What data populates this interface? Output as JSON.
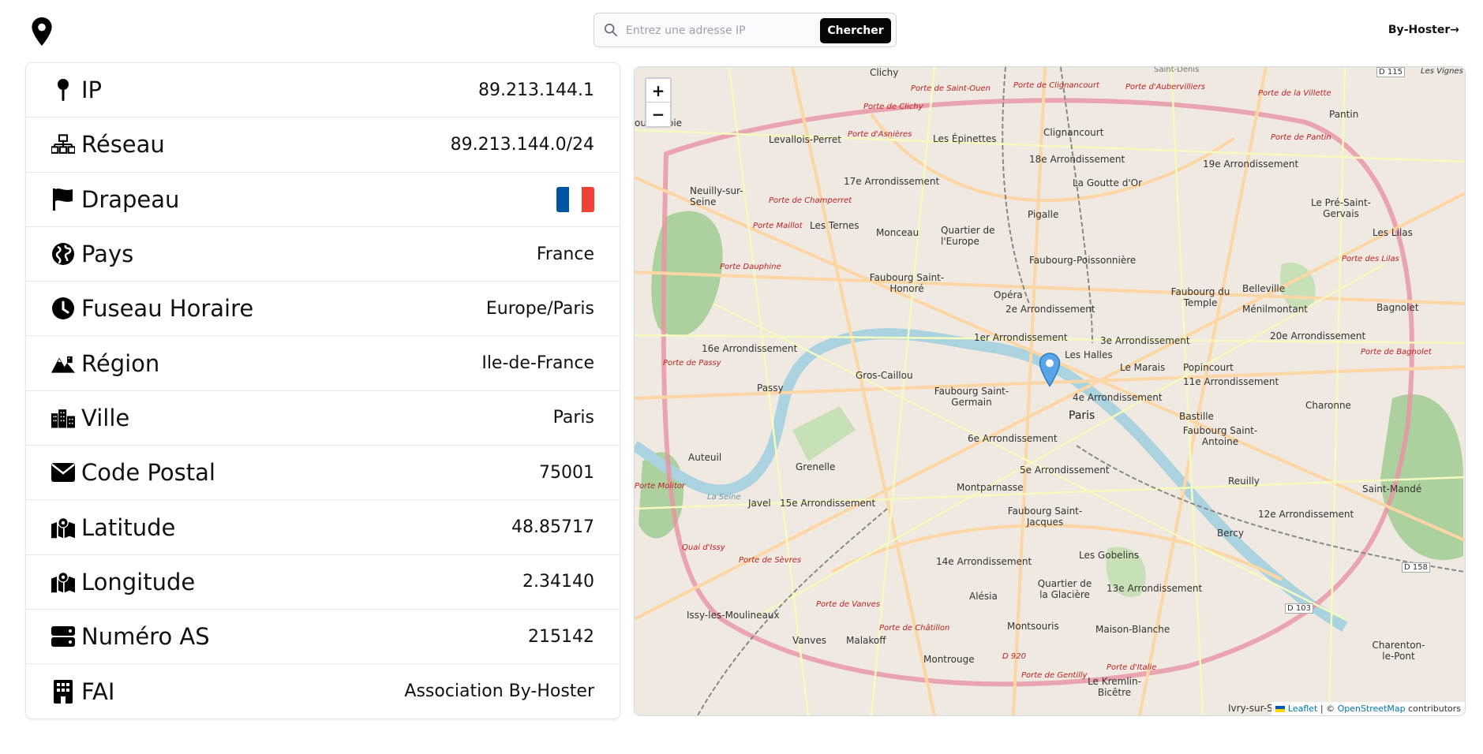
{
  "header": {
    "search": {
      "placeholder": "Entrez une adresse IP",
      "button_label": "Chercher"
    },
    "brand_link": "By-Hoster→"
  },
  "info": {
    "rows": [
      {
        "label": "IP",
        "value": "89.213.144.1",
        "icon": "pin-icon"
      },
      {
        "label": "Réseau",
        "value": "89.213.144.0/24",
        "icon": "network-icon"
      },
      {
        "label": "Drapeau",
        "value": "",
        "icon": "flag-icon"
      },
      {
        "label": "Pays",
        "value": "France",
        "icon": "globe-icon"
      },
      {
        "label": "Fuseau Horaire",
        "value": "Europe/Paris",
        "icon": "clock-icon"
      },
      {
        "label": "Région",
        "value": "Ile-de-France",
        "icon": "mountain-city-icon"
      },
      {
        "label": "Ville",
        "value": "Paris",
        "icon": "city-icon"
      },
      {
        "label": "Code Postal",
        "value": "75001",
        "icon": "envelope-icon"
      },
      {
        "label": "Latitude",
        "value": "48.85717",
        "icon": "map-location-icon"
      },
      {
        "label": "Longitude",
        "value": "2.34140",
        "icon": "map-location-icon"
      },
      {
        "label": "Numéro AS",
        "value": "215142",
        "icon": "server-icon"
      },
      {
        "label": "FAI",
        "value": "Association By-Hoster",
        "icon": "building-icon"
      }
    ],
    "flag_colors": [
      "#0055A4",
      "#FFFFFF",
      "#EF4135"
    ]
  },
  "map": {
    "zoom_in": "+",
    "zoom_out": "−",
    "labels": {
      "clichy": "Clichy",
      "levallois": "Levallois-Perret",
      "neuilly": "Neuilly-sur-Seine",
      "epinettes": "Les Épinettes",
      "clignancourt": "Clignancourt",
      "arr18": "18e Arrondissement",
      "goutte": "La Goutte d'Or",
      "arr17": "17e Arrondissement",
      "ternes": "Les Ternes",
      "monceau": "Monceau",
      "europe": "Quartier de l'Europe",
      "pigalle": "Pigalle",
      "poissonniere": "Faubourg-Poissonnière",
      "arr19": "19e Arrondissement",
      "pantin": "Pantin",
      "prestgervais": "Le Pré-Saint-Gervais",
      "lilas": "Les Lilas",
      "honore": "Faubourg Saint-Honoré",
      "opera": "Opéra",
      "arr2": "2e Arrondissement",
      "temple": "Faubourg du Temple",
      "belleville": "Belleville",
      "menilmontant": "Ménilmontant",
      "bagnolet": "Bagnolet",
      "arr16": "16e Arrondissement",
      "arr1": "1er Arrondissement",
      "halles": "Les Halles",
      "arr3": "3e Arrondissement",
      "arr20": "20e Arrondissement",
      "marais": "Le Marais",
      "popincourt": "Popincourt",
      "arr11": "11e Arrondissement",
      "passy": "Passy",
      "groscaillou": "Gros-Caillou",
      "germain": "Faubourg Saint-Germain",
      "arr4": "4e Arrondissement",
      "paris": "Paris",
      "bastille": "Bastille",
      "antoine": "Faubourg Saint-Antoine",
      "charonne": "Charonne",
      "arr6": "6e Arrondissement",
      "auteuil": "Auteuil",
      "grenelle": "Grenelle",
      "arr5": "5e Arrondissement",
      "montparnasse": "Montparnasse",
      "reuilly": "Reuilly",
      "stmande": "Saint-Mandé",
      "javel": "Javel",
      "arr15": "15e Arrondissement",
      "jacques": "Faubourg Saint-Jacques",
      "arr12": "12e Arrondissement",
      "bercy": "Bercy",
      "gobelins": "Les Gobelins",
      "arr14": "14e Arrondissement",
      "glaciere": "Quartier de la Glacière",
      "arr13": "13e Arrondissement",
      "alesia": "Alésia",
      "issy": "Issy-les-Moulineaux",
      "vanves": "Vanves",
      "malakoff": "Malakoff",
      "montsouris": "Montsouris",
      "maisonblanche": "Maison-Blanche",
      "charenton": "Charenton-le-Pont",
      "montrouge": "Montrouge",
      "kremlin": "Le Kremlin-Bicêtre",
      "ivry": "Ivry-sur-Se",
      "stdenis": "Saint-Denis",
      "vignes": "Les Vignes",
      "d115": "D 115",
      "d158": "D 158",
      "d103": "D 103",
      "d920": "D 920",
      "courbevoie": "ourbevoie",
      "portes": {
        "clichy": "Porte de Clichy",
        "stouen": "Porte de Saint-Ouen",
        "clignancourt": "Porte de Clignancourt",
        "aubervilliers": "Porte d'Aubervilliers",
        "villette": "Porte de la Villette",
        "pantin": "Porte de Pantin",
        "asnieres": "Porte d'Asnières",
        "champerret": "Porte de Champerret",
        "maillot": "Porte Maillot",
        "dauphine": "Porte Dauphine",
        "lilas": "Porte des Lilas",
        "bagnolet": "Porte de Bagnolet",
        "passy": "Porte de Passy",
        "molitor": "Porte Molitor",
        "sevres": "Porte de Sèvres",
        "vanves": "Porte de Vanves",
        "chatillon": "Porte de Châtillon",
        "gentilly": "Porte de Gentilly",
        "italie": "Porte d'Italie"
      },
      "seine": "La Seine",
      "quai": "Quai d'Issy"
    },
    "attribution": {
      "leaflet": "Leaflet",
      "separator": " | © ",
      "osm": "OpenStreetMap",
      "suffix": " contributors"
    }
  }
}
